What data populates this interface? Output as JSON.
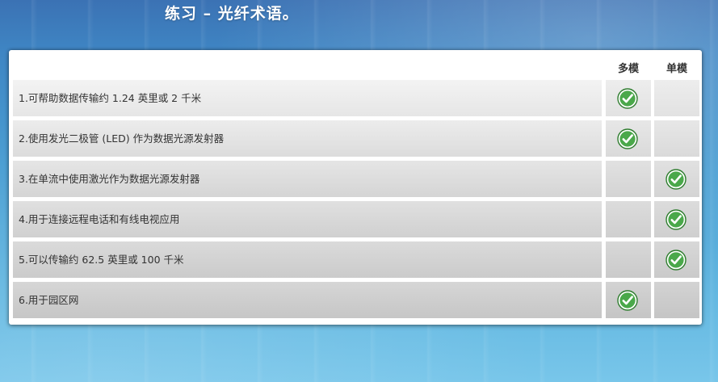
{
  "title": "练习 – 光纤术语。",
  "columns": {
    "multi": "多模",
    "single": "单模"
  },
  "rows": [
    {
      "label": "1.可帮助数据传输约 1.24 英里或 2 千米",
      "multi": true,
      "single": false
    },
    {
      "label": "2.使用发光二极管 (LED) 作为数据光源发射器",
      "multi": true,
      "single": false
    },
    {
      "label": "3.在单流中使用激光作为数据光源发射器",
      "multi": false,
      "single": true
    },
    {
      "label": "4.用于连接远程电话和有线电视应用",
      "multi": false,
      "single": true
    },
    {
      "label": "5.可以传输约 62.5 英里或 100 千米",
      "multi": false,
      "single": true
    },
    {
      "label": "6.用于园区网",
      "multi": true,
      "single": false
    }
  ],
  "icons": {
    "check": "check-circle-icon"
  },
  "colors": {
    "check_green": "#4aa84a",
    "check_border": "#2f7d2f"
  }
}
